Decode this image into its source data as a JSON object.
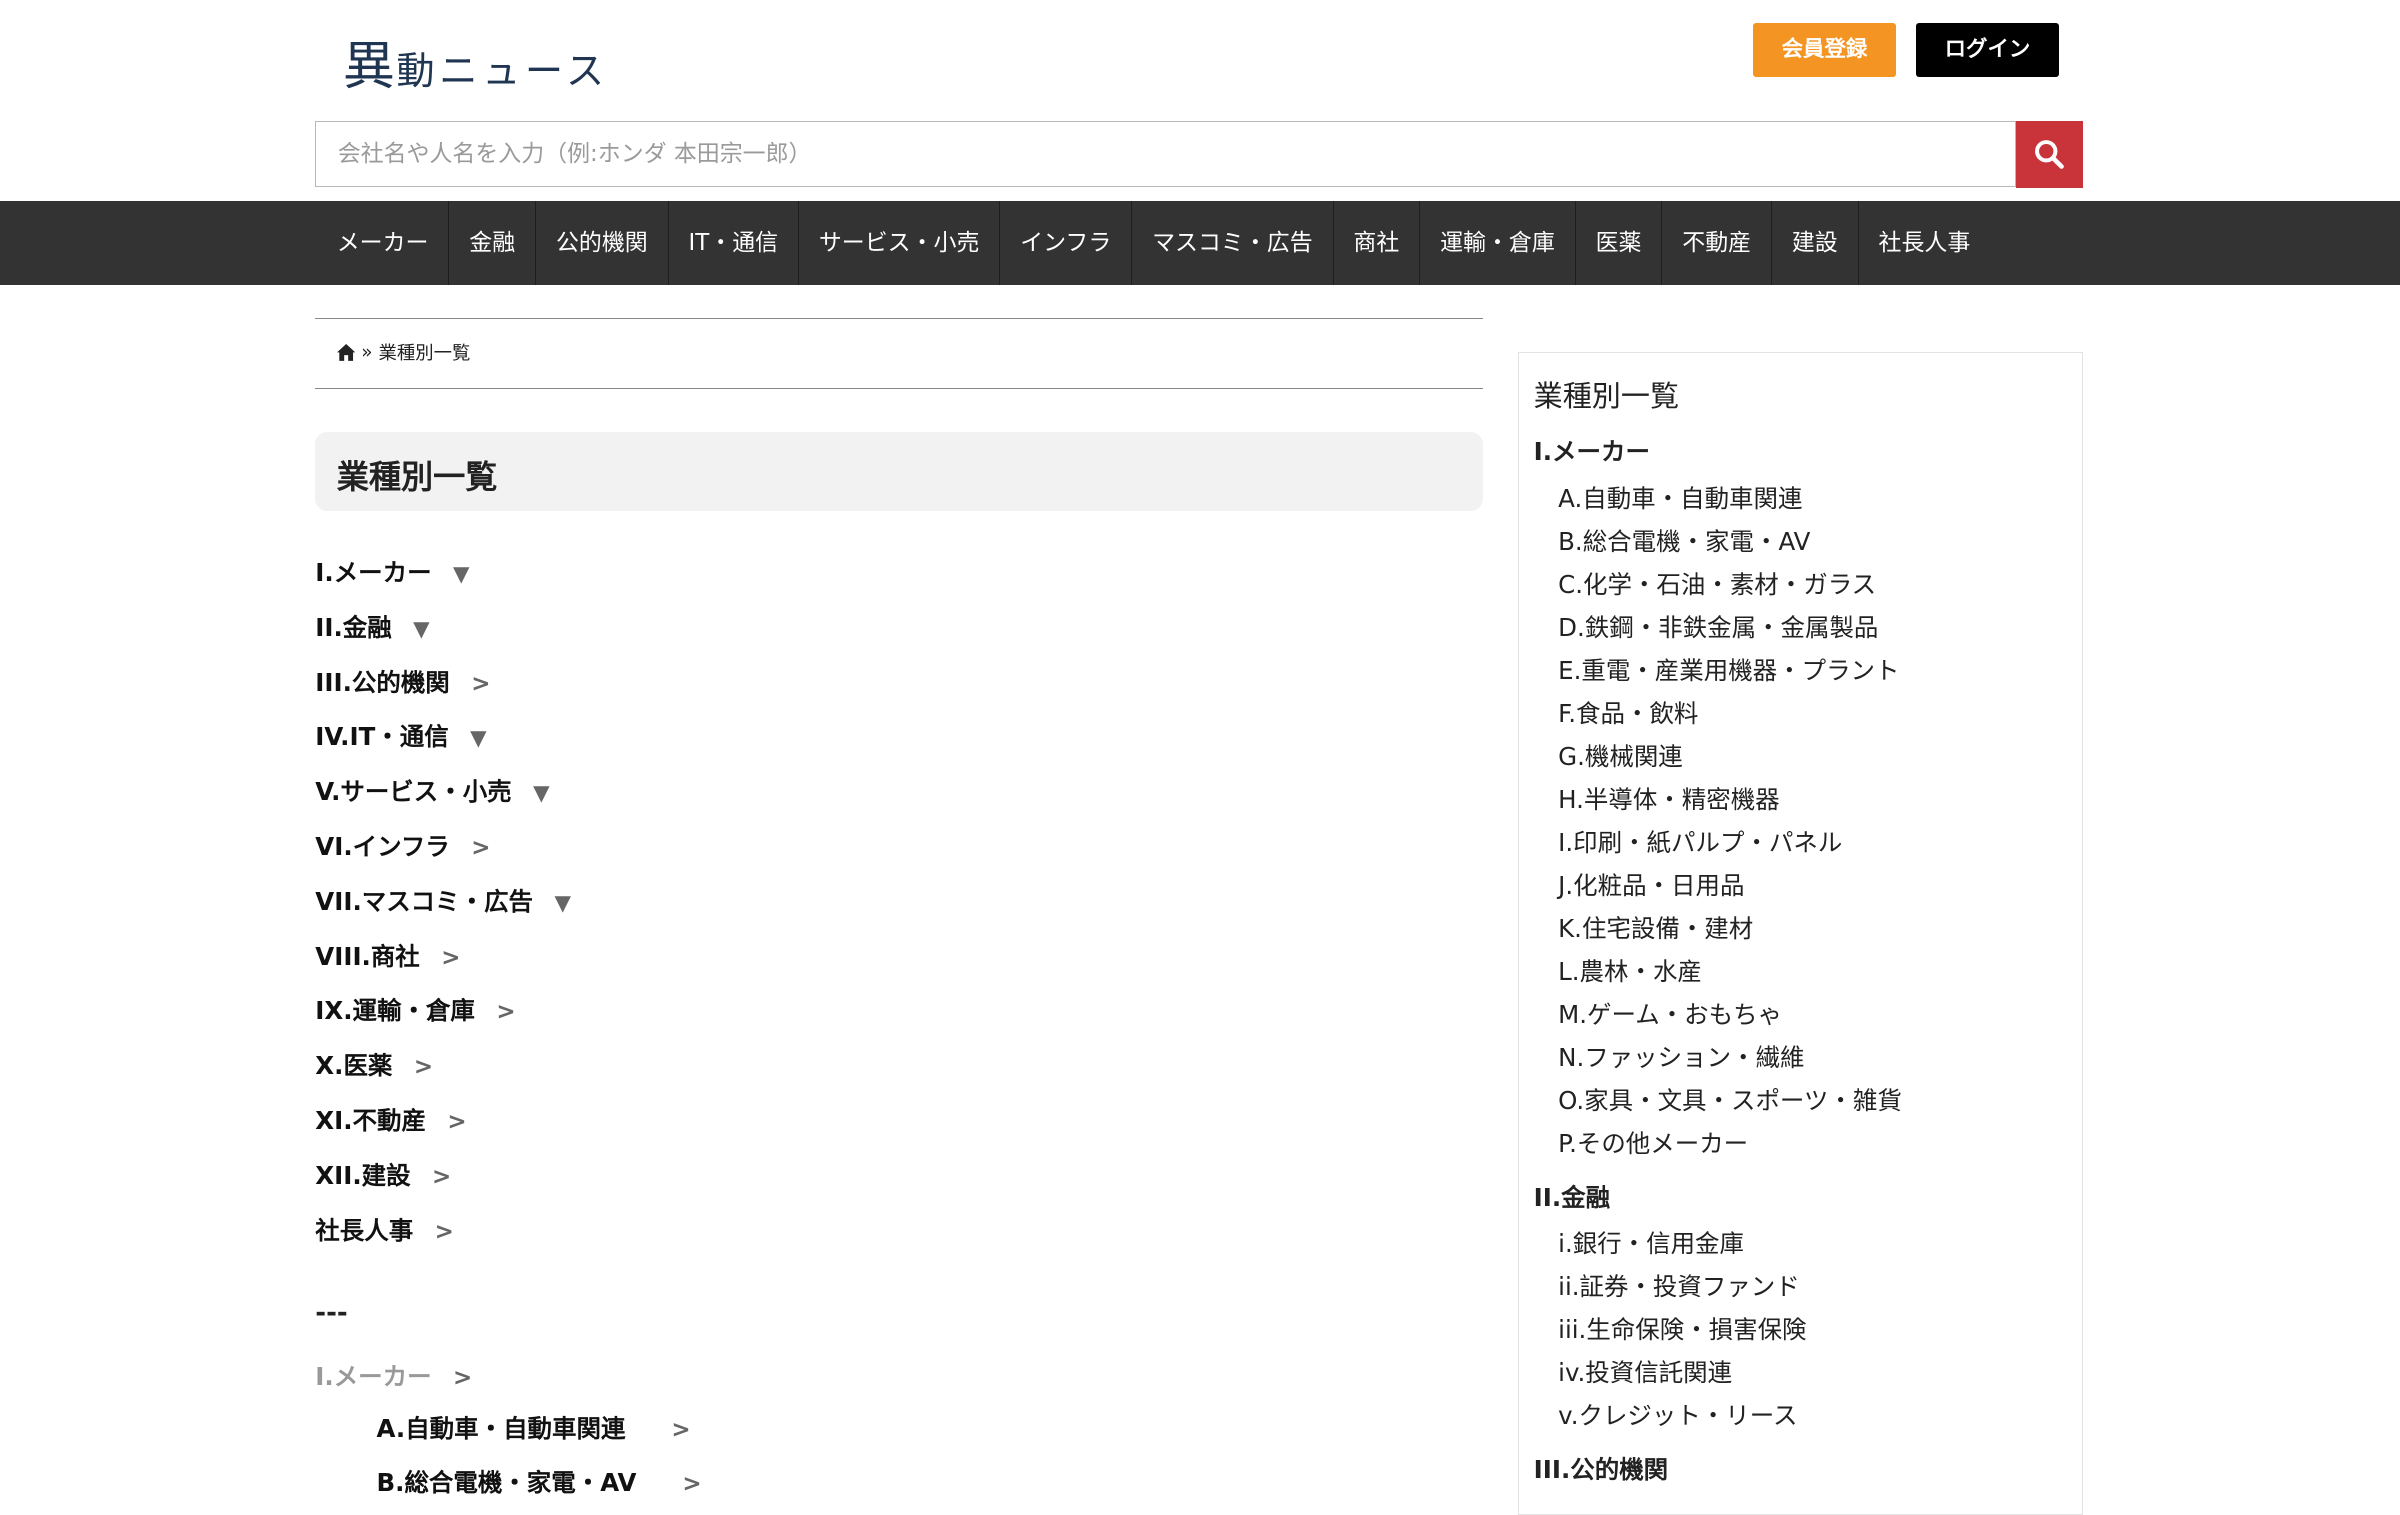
{
  "header": {
    "logo_main": "異",
    "logo_rest": "動ニュース",
    "register_label": "会員登録",
    "login_label": "ログイン",
    "search_placeholder": "会社名や人名を入力（例:ホンダ 本田宗一郎）"
  },
  "nav": [
    "メーカー",
    "金融",
    "公的機関",
    "IT・通信",
    "サービス・小売",
    "インフラ",
    "マスコミ・広告",
    "商社",
    "運輸・倉庫",
    "医薬",
    "不動産",
    "建設",
    "社長人事"
  ],
  "breadcrumb": {
    "separator": "»",
    "current": "業種別一覧"
  },
  "main": {
    "title": "業種別一覧",
    "categories": [
      {
        "label": "I.メーカー",
        "arrow": "▼"
      },
      {
        "label": "II.金融",
        "arrow": "▼"
      },
      {
        "label": "III.公的機関",
        "arrow": ">"
      },
      {
        "label": "IV.IT・通信",
        "arrow": "▼"
      },
      {
        "label": "V.サービス・小売",
        "arrow": "▼"
      },
      {
        "label": "VI.インフラ",
        "arrow": ">"
      },
      {
        "label": "VII.マスコミ・広告",
        "arrow": "▼"
      },
      {
        "label": "VIII.商社",
        "arrow": ">"
      },
      {
        "label": "IX.運輸・倉庫",
        "arrow": ">"
      },
      {
        "label": "X.医薬",
        "arrow": ">"
      },
      {
        "label": "XI.不動産",
        "arrow": ">"
      },
      {
        "label": "XII.建設",
        "arrow": ">"
      },
      {
        "label": "社長人事",
        "arrow": ">"
      }
    ],
    "divider": "---",
    "sub_heading": {
      "label": "I.メーカー",
      "arrow": ">"
    },
    "sub_items": [
      {
        "label": "A.自動車・自動車関連",
        "arrow": ">"
      },
      {
        "label": "B.総合電機・家電・AV",
        "arrow": ">"
      }
    ]
  },
  "sidebar": {
    "title": "業種別一覧",
    "groups": [
      {
        "heading": "I.メーカー",
        "items": [
          "A.自動車・自動車関連",
          "B.総合電機・家電・AV",
          "C.化学・石油・素材・ガラス",
          "D.鉄鋼・非鉄金属・金属製品",
          "E.重電・産業用機器・プラント",
          "F.食品・飲料",
          "G.機械関連",
          "H.半導体・精密機器",
          "I.印刷・紙パルプ・パネル",
          "J.化粧品・日用品",
          "K.住宅設備・建材",
          "L.農林・水産",
          "M.ゲーム・おもちゃ",
          "N.ファッション・繊維",
          "O.家具・文具・スポーツ・雑貨",
          "P.その他メーカー"
        ]
      },
      {
        "heading": "II.金融",
        "items": [
          "i.銀行・信用金庫",
          "ii.証券・投資ファンド",
          "iii.生命保険・損害保険",
          "iv.投資信託関連",
          "v.クレジット・リース"
        ]
      },
      {
        "heading": "III.公的機関",
        "items": []
      }
    ]
  },
  "colors": {
    "accent_orange": "#f49422",
    "search_red": "#c9333a",
    "nav_bg": "#333333"
  }
}
